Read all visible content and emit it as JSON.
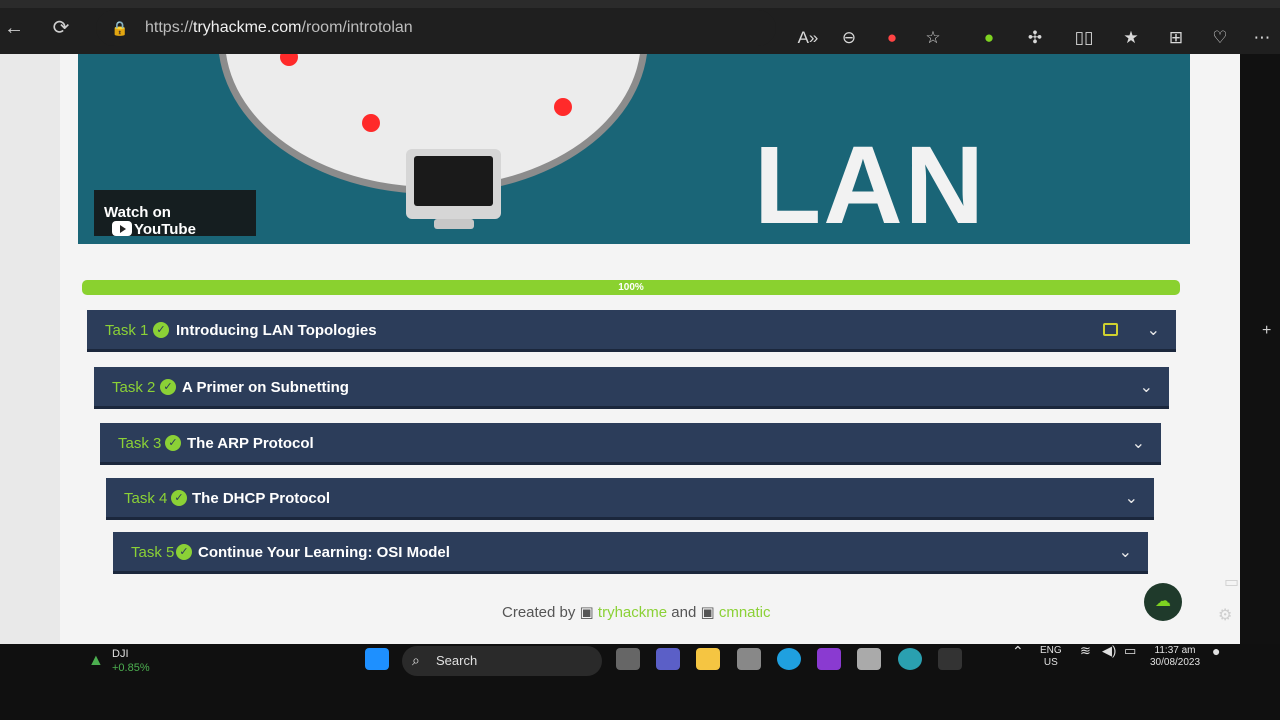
{
  "browser": {
    "url_prefix": "https://",
    "url_domain": "tryhackme.com",
    "url_path": "/room/introtolan",
    "back": "←",
    "reload": "⟳",
    "lock": "🔒",
    "read_aloud": "A»",
    "zoom_out": "⊖",
    "bookmark": "☆",
    "split": "▯▯",
    "favorites": "★",
    "collections": "⊞",
    "health": "♡",
    "more": "⋯"
  },
  "video": {
    "heading": "LAN",
    "watch_on": "Watch on",
    "youtube": "YouTube"
  },
  "progress": {
    "label": "100%",
    "value": 100
  },
  "tasks": [
    {
      "num": "Task 1",
      "title": "Introducing LAN Topologies"
    },
    {
      "num": "Task 2",
      "title": "A Primer on Subnetting"
    },
    {
      "num": "Task 3",
      "title": "The ARP Protocol"
    },
    {
      "num": "Task 4",
      "title": "The DHCP Protocol"
    },
    {
      "num": "Task 5",
      "title": "Continue Your Learning: OSI Model"
    }
  ],
  "credits": {
    "created_by": "Created by",
    "user1": "tryhackme",
    "and": "and",
    "user2": "cmnatic"
  },
  "taskbar": {
    "stock_name": "DJI",
    "stock_change": "+0.85%",
    "search_label": "Search",
    "lang_top": "ENG",
    "lang_bottom": "US",
    "time": "11:37 am",
    "date": "30/08/2023"
  },
  "colors": {
    "task_bg": "#2c3d5a",
    "accent_green": "#8bd136",
    "video_bg": "#1a6577"
  }
}
